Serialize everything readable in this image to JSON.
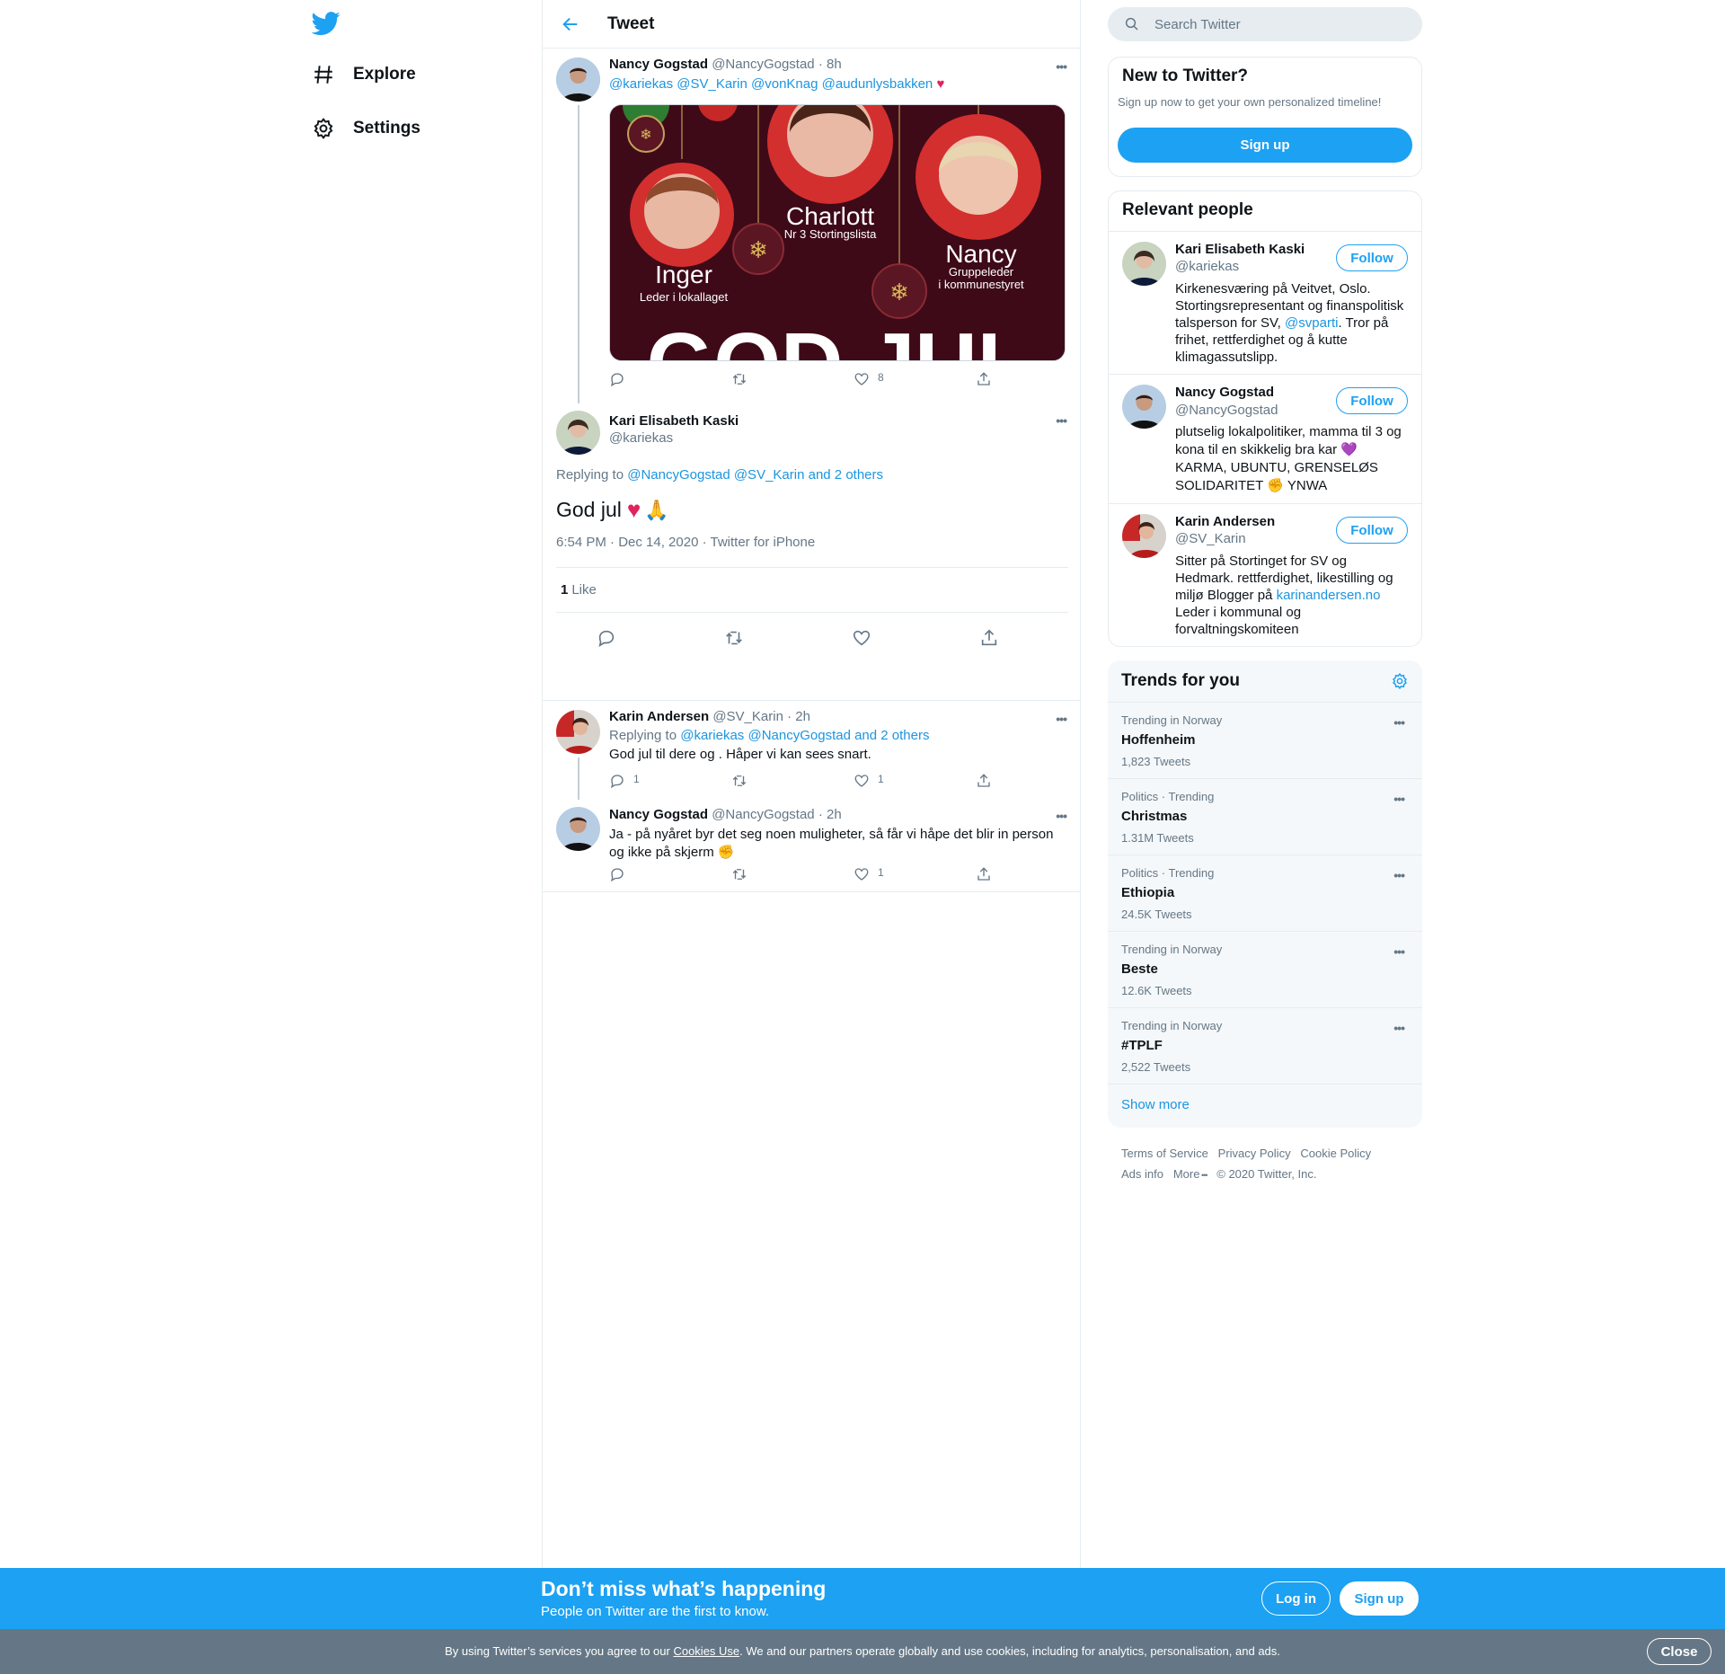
{
  "nav": {
    "explore": "Explore",
    "settings": "Settings"
  },
  "header": {
    "title": "Tweet"
  },
  "parent_tweet": {
    "name": "Nancy Gogstad",
    "handle": "@NancyGogstad",
    "time": "· 8h",
    "mentions": "@kariekas @SV_Karin @vonKnag @audunlysbakken",
    "emoji": "♥",
    "image": {
      "names": [
        "Inger",
        "Charlott",
        "Nancy"
      ],
      "roles": [
        "Leder i lokallaget",
        "Nr 3 Stortingslista",
        "Gruppeleder",
        "i kommunestyret"
      ],
      "banner": "GOD JUL"
    },
    "like_count": "8"
  },
  "main_tweet": {
    "name": "Kari Elisabeth Kaski",
    "handle": "@kariekas",
    "replying_prefix": "Replying to",
    "replying_to": "@NancyGogstad @SV_Karin",
    "replying_more": "and 2 others",
    "text": "God jul",
    "emoji_heart": "♥",
    "emoji_pray": "🙏",
    "meta": "6:54 PM · Dec 14, 2020 · Twitter for iPhone",
    "likes_count": "1",
    "likes_label": "Like"
  },
  "replies": [
    {
      "name": "Karin Andersen",
      "handle": "@SV_Karin",
      "time": "· 2h",
      "replying_prefix": "Replying to",
      "replying_to": "@kariekas @NancyGogstad and 2 others",
      "text": "God jul til dere og . Håper vi kan sees snart.",
      "reply_count": "1",
      "like_count": "1"
    },
    {
      "name": "Nancy Gogstad",
      "handle": "@NancyGogstad",
      "time": "· 2h",
      "text": "Ja - på nyåret byr det seg noen muligheter, så får vi håpe det blir in person og ikke på skjerm",
      "emoji": "✊",
      "like_count": "1"
    }
  ],
  "search": {
    "placeholder": "Search Twitter"
  },
  "new_to_twitter": {
    "title": "New to Twitter?",
    "text": "Sign up now to get your own personalized timeline!",
    "button": "Sign up"
  },
  "relevant": {
    "title": "Relevant people",
    "follow_label": "Follow",
    "people": [
      {
        "name": "Kari Elisabeth Kaski",
        "handle": "@kariekas",
        "bio_1": "Kirkenesværing på Veitvet, Oslo. Stortingsrepresentant og finanspolitisk talsperson for SV,",
        "bio_link": "@svparti",
        "bio_2": ". Tror på frihet, rettferdighet og å kutte klimagassutslipp."
      },
      {
        "name": "Nancy Gogstad",
        "handle": "@NancyGogstad",
        "bio_1": "plutselig lokalpolitiker, mamma til 3 og kona til en skikkelig bra kar",
        "bio_emoji": "💜",
        "bio_2": "KARMA, UBUNTU, GRENSELØS SOLIDARITET",
        "bio_emoji2": "✊",
        "bio_3": "YNWA"
      },
      {
        "name": "Karin Andersen",
        "handle": "@SV_Karin",
        "bio_1": "Sitter på Stortinget for SV og Hedmark. rettferdighet, likestilling og miljø Blogger på",
        "bio_link": "karinandersen.no",
        "bio_2": "Leder i kommunal og forvaltningskomiteen"
      }
    ]
  },
  "trends": {
    "title": "Trends for you",
    "items": [
      {
        "context": "Trending in Norway",
        "name": "Hoffenheim",
        "count": "1,823 Tweets"
      },
      {
        "context": "Politics · Trending",
        "name": "Christmas",
        "count": "1.31M Tweets"
      },
      {
        "context": "Politics · Trending",
        "name": "Ethiopia",
        "count": "24.5K Tweets"
      },
      {
        "context": "Trending in Norway",
        "name": "Beste",
        "count": "12.6K Tweets"
      },
      {
        "context": "Trending in Norway",
        "name": "#TPLF",
        "count": "2,522 Tweets"
      }
    ],
    "show_more": "Show more"
  },
  "footer": {
    "terms": "Terms of Service",
    "privacy": "Privacy Policy",
    "cookie": "Cookie Policy",
    "ads": "Ads info",
    "more": "More",
    "copyright": "© 2020 Twitter, Inc."
  },
  "banner": {
    "title": "Don’t miss what’s happening",
    "subtitle": "People on Twitter are the first to know.",
    "login": "Log in",
    "signup": "Sign up"
  },
  "cookie_bar": {
    "text_1": "By using Twitter’s services you agree to our",
    "link": "Cookies Use",
    "text_2": ". We and our partners operate globally and use cookies, including for analytics, personalisation, and ads.",
    "close": "Close"
  },
  "colors": {
    "accent": "#1da1f2",
    "link": "#1b95e0",
    "muted": "#657786",
    "cookie_bg": "#657786",
    "heart_red": "#e0245e"
  }
}
